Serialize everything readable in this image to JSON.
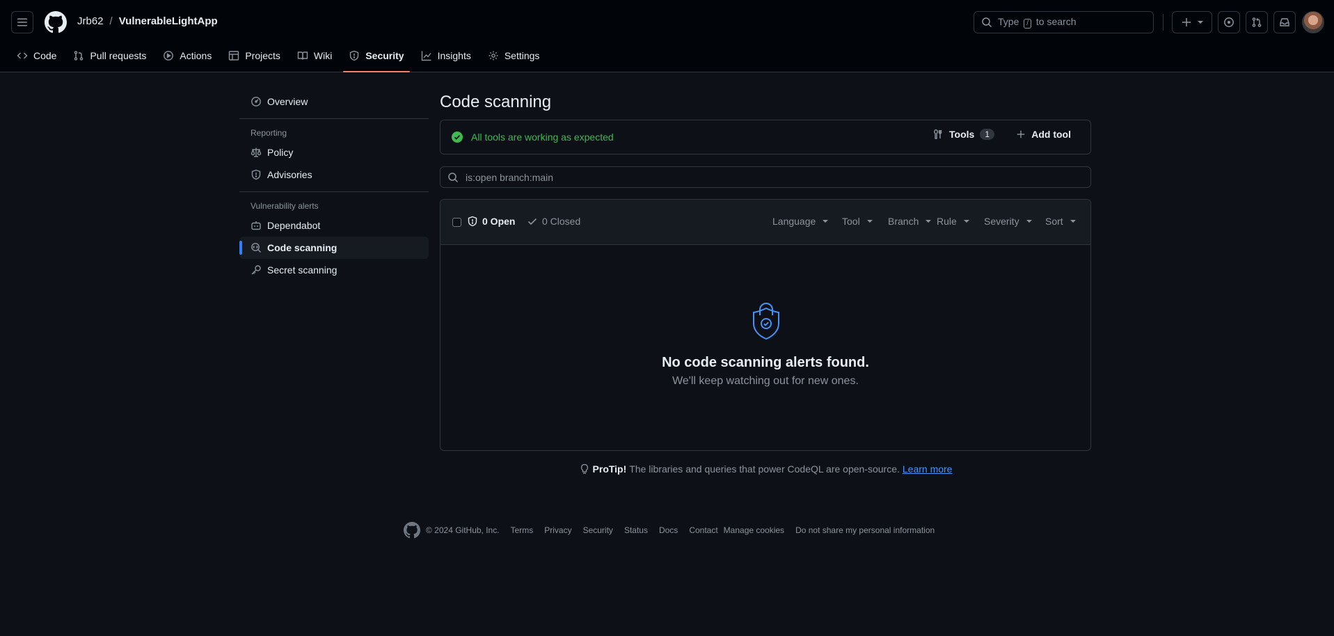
{
  "header": {
    "owner": "Jrb62",
    "separator": "/",
    "repo": "VulnerableLightApp",
    "search": {
      "prefix": "Type",
      "key": "/",
      "suffix": "to search"
    }
  },
  "tabs": [
    {
      "label": "Code",
      "icon": "code-icon"
    },
    {
      "label": "Pull requests",
      "icon": "git-pull-request-icon"
    },
    {
      "label": "Actions",
      "icon": "play-icon"
    },
    {
      "label": "Projects",
      "icon": "table-icon"
    },
    {
      "label": "Wiki",
      "icon": "book-icon"
    },
    {
      "label": "Security",
      "icon": "shield-icon",
      "active": true
    },
    {
      "label": "Insights",
      "icon": "graph-icon"
    },
    {
      "label": "Settings",
      "icon": "gear-icon"
    }
  ],
  "sidebar": {
    "overview": "Overview",
    "reporting_label": "Reporting",
    "policy": "Policy",
    "advisories": "Advisories",
    "vuln_label": "Vulnerability alerts",
    "dependabot": "Dependabot",
    "code_scanning": "Code scanning",
    "secret_scanning": "Secret scanning"
  },
  "main": {
    "title": "Code scanning",
    "status": "All tools are working as expected",
    "tools_label": "Tools",
    "tools_count": "1",
    "add_tool": "Add tool",
    "filter_value": "is:open branch:main",
    "open_label": "0 Open",
    "closed_label": "0 Closed",
    "filters": [
      "Language",
      "Tool",
      "Branch",
      "Rule",
      "Severity",
      "Sort"
    ],
    "empty_title": "No code scanning alerts found.",
    "empty_sub": "We'll keep watching out for new ones."
  },
  "protip": {
    "label": "ProTip!",
    "text": "The libraries and queries that power CodeQL are open-source.",
    "link": "Learn more"
  },
  "footer": {
    "copyright": "© 2024 GitHub, Inc.",
    "links": [
      "Terms",
      "Privacy",
      "Security",
      "Status",
      "Docs",
      "Contact",
      "Manage cookies",
      "Do not share my personal information"
    ]
  },
  "colors": {
    "accent": "#2f81f7",
    "tab_underline": "#f78166",
    "success": "#3fb950",
    "link": "#4493f8",
    "bg": "#0d1117"
  }
}
